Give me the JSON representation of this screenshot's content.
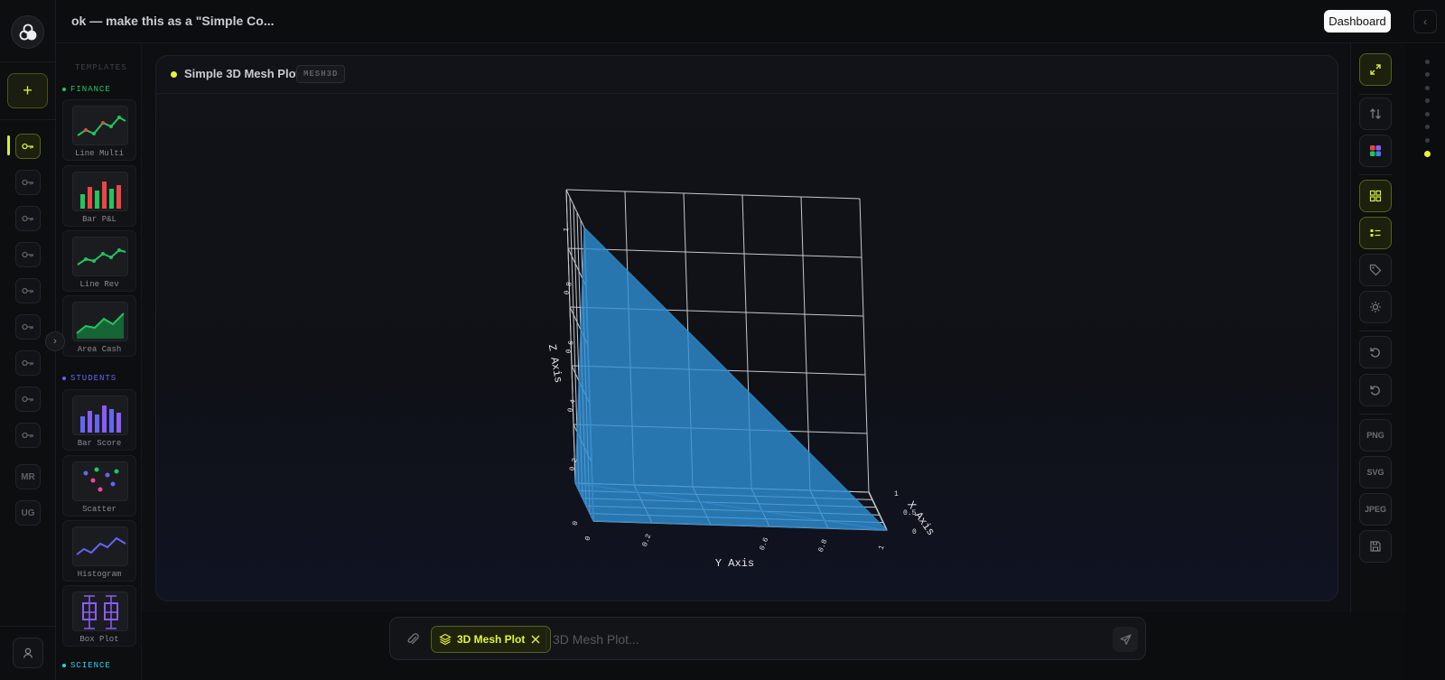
{
  "header": {
    "title": "ok — make this as a \"Simple Co...",
    "dashboard_label": "Dashboard",
    "collapse_icon": "chevron-left-icon"
  },
  "rail": {
    "add_label": "+",
    "items": [
      {
        "icon": "key-icon",
        "active": true
      },
      {
        "icon": "key-icon"
      },
      {
        "icon": "key-icon"
      },
      {
        "icon": "key-icon"
      },
      {
        "icon": "key-icon"
      },
      {
        "icon": "key-icon"
      },
      {
        "icon": "key-icon"
      },
      {
        "icon": "key-icon"
      },
      {
        "icon": "key-icon"
      }
    ],
    "initials": [
      "MR",
      "UG"
    ]
  },
  "templates": {
    "heading": "TEMPLATES",
    "sections": [
      {
        "label": "FINANCE",
        "color": "#22c55e",
        "items": [
          {
            "label": "Line Multi",
            "icon": "line-chart-icon"
          },
          {
            "label": "Bar P&L",
            "icon": "bar-chart-icon"
          },
          {
            "label": "Line Rev",
            "icon": "line-chart-icon"
          },
          {
            "label": "Area Cash",
            "icon": "area-chart-icon"
          }
        ]
      },
      {
        "label": "STUDENTS",
        "color": "#6366f1",
        "items": [
          {
            "label": "Bar Score",
            "icon": "bar-chart-icon"
          },
          {
            "label": "Scatter",
            "icon": "scatter-chart-icon"
          },
          {
            "label": "Histogram",
            "icon": "line-chart-icon"
          },
          {
            "label": "Box Plot",
            "icon": "box-plot-icon"
          }
        ]
      },
      {
        "label": "SCIENCE",
        "color": "#22d3ee",
        "items": []
      }
    ]
  },
  "plot": {
    "title": "Simple 3D Mesh Plot",
    "badge": "MESH3D",
    "mesh_color": "#2f8fd6"
  },
  "chart_data": {
    "type": "mesh3d",
    "x": [
      0,
      1,
      0,
      0
    ],
    "y": [
      0,
      0,
      1,
      0
    ],
    "z": [
      0,
      0,
      0,
      1
    ],
    "xlabel": "X Axis",
    "ylabel": "Y Axis",
    "zlabel": "Z Axis",
    "x_ticks": [
      "0",
      "0.5",
      "1"
    ],
    "y_ticks": [
      "0",
      "0.2",
      "0.6",
      "0.8",
      "1"
    ],
    "z_ticks": [
      "0",
      "0.2",
      "0.4",
      "0.6",
      "0.8",
      "1"
    ],
    "grid": true
  },
  "tools": {
    "items": [
      "expand-icon",
      "swap-icon",
      "palette-icon",
      "grid-icon",
      "list-icon",
      "tag-icon",
      "sun-icon",
      "undo-icon",
      "reset-icon"
    ],
    "png_label": "PNG",
    "svg_label": "SVG",
    "jpeg_label": "JPEG",
    "save_icon": "save-icon"
  },
  "composer": {
    "chip_label": "3D Mesh Plot",
    "placeholder": "3D Mesh Plot..."
  },
  "pager": {
    "count": 8,
    "active": 7
  }
}
